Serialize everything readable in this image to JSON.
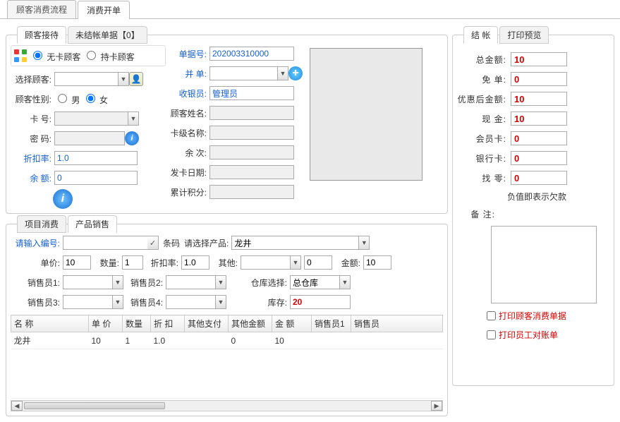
{
  "topTabs": {
    "flow": "顾客消费流程",
    "bill": "消费开单"
  },
  "receptionTabs": {
    "reception": "顾客接待",
    "unsettled": "未结帐单据【0】"
  },
  "customerType": {
    "noCard": "无卡顾客",
    "cardHolder": "持卡顾客"
  },
  "left": {
    "selectCustomer": "选择顾客:",
    "gender": "顾客性别:",
    "male": "男",
    "female": "女",
    "cardNo": "卡  号:",
    "password": "密  码:",
    "discount": "折扣率:",
    "discountVal": "1.0",
    "balance": "余  额:",
    "balanceVal": "0"
  },
  "mid": {
    "billNo": "单据号:",
    "billNoVal": "202003310000",
    "merge": "并  单:",
    "cashier": "收银员:",
    "cashierVal": "管理员",
    "custName": "顾客姓名:",
    "cardLevel": "卡级名称:",
    "times": "余  次:",
    "issueDate": "发卡日期:",
    "points": "累计积分:"
  },
  "innerTabs": {
    "item": "项目消费",
    "product": "产品销售"
  },
  "product": {
    "codeLbl": "请输入编号:",
    "barcodeLbl": "条码",
    "selectProdLbl": "请选择产品:",
    "selectedProduct": "龙井",
    "priceLbl": "单价:",
    "priceVal": "10",
    "qtyLbl": "数量:",
    "qtyVal": "1",
    "discLbl": "折扣率:",
    "discVal": "1.0",
    "otherLbl": "其他:",
    "otherVal": "0",
    "amountLbl": "金额:",
    "amountVal": "10",
    "s1": "销售员1:",
    "s2": "销售员2:",
    "s3": "销售员3:",
    "s4": "销售员4:",
    "whLbl": "仓库选择:",
    "whVal": "总仓库",
    "stockLbl": "库存:",
    "stockVal": "20"
  },
  "gridCols": {
    "name": "名 称",
    "price": "单 价",
    "qty": "数量",
    "disc": "折  扣",
    "other": "其他支付",
    "otherAmt": "其他金额",
    "amt": "金  额",
    "s1": "销售员1",
    "s2": "销售员"
  },
  "gridRow": {
    "name": "龙井",
    "price": "10",
    "qty": "1",
    "disc": "1.0",
    "other": "",
    "otherAmt": "0",
    "amt": "10",
    "s1": "",
    "s2": ""
  },
  "payTabs": {
    "settle": "结  帐",
    "preview": "打印预览"
  },
  "pay": {
    "total": "总金额:",
    "totalVal": "10",
    "free": "免  单:",
    "freeVal": "0",
    "afterDisc": "优惠后金额:",
    "afterDiscVal": "10",
    "cash": "现  金:",
    "cashVal": "10",
    "member": "会员卡:",
    "memberVal": "0",
    "bank": "银行卡:",
    "bankVal": "0",
    "change": "找  零:",
    "changeVal": "0",
    "negNote": "负值即表示欠款",
    "remark": "备  注:",
    "printCust": "打印顾客消费单据",
    "printStaff": "打印员工对账单"
  }
}
